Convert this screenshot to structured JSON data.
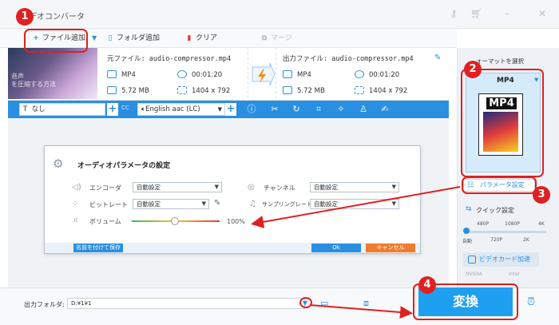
{
  "window": {
    "title": "デオコンバータ"
  },
  "toolbar": {
    "add_file": "ファイル追加",
    "add_folder": "フォルダ追加",
    "clear": "クリア",
    "merge": "マージ"
  },
  "file": {
    "thumb_text_1": "音声",
    "thumb_text_2": "を圧縮する方法",
    "source_label": "元ファイル: audio-compressor.mp4",
    "output_label": "出力ファイル: audio-compressor.mp4",
    "src_format": "MP4",
    "src_duration": "00:01:20",
    "src_size": "5.72 MB",
    "src_resolution": "1404 x 792",
    "out_format": "MP4",
    "out_duration": "00:01:20",
    "out_size": "5.72 MB",
    "out_resolution": "1404 x 792"
  },
  "editbar": {
    "subtitle": "なし",
    "audio": "English aac (LC)"
  },
  "dialog": {
    "title": "オーディオパラメータの設定",
    "encoder_label": "エンコーダ",
    "encoder_value": "自動設定",
    "channel_label": "チャンネル",
    "channel_value": "自動設定",
    "bitrate_label": "ビットレート",
    "bitrate_value": "自動設定",
    "samplerate_label": "サンプリングレート",
    "samplerate_value": "自動設定",
    "volume_label": "ボリューム",
    "volume_value": "100%",
    "save_preset": "名前を付けて保存",
    "ok": "Ok",
    "cancel": "キャンセル"
  },
  "right_panel": {
    "format_title": "ォーマットを選択",
    "format_name": "MP4",
    "format_badge": "MP4",
    "param_button": "パラメータ設定",
    "quick_title": "クイック設定",
    "ticks_top": [
      "480P",
      "1080P",
      "4K"
    ],
    "ticks_bottom": [
      "自動",
      "720P",
      "2K"
    ],
    "gpu_label": "ビデオカード加速",
    "nvidia": "NVIDIA",
    "intel": "Intel"
  },
  "bottom": {
    "output_folder_label": "出力フォルダ:",
    "output_folder_value": "D:¥1¥1",
    "convert": "変換"
  },
  "steps": [
    "1",
    "2",
    "3",
    "4"
  ],
  "colors": {
    "accent": "#2a8fe0",
    "annotation": "#e02020",
    "convert": "#1f9ff0",
    "cancel": "#f17c2d"
  }
}
